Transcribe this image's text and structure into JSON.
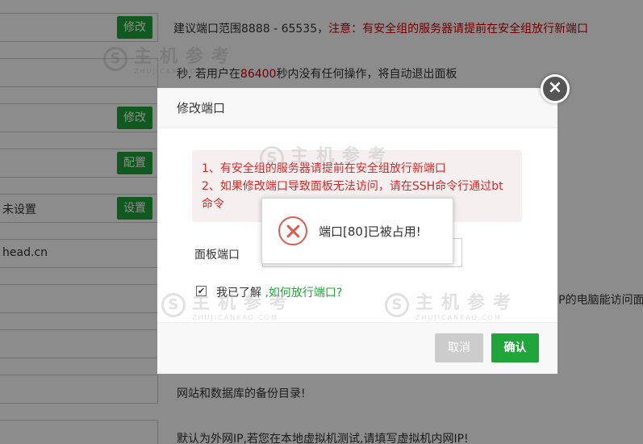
{
  "background": {
    "rows": [
      {
        "value": "",
        "button": "修改",
        "hint": "建议端口范围8888 - 65535，",
        "hint_red": "注意：有安全组的服务器请提前在安全组放行新端口"
      },
      {
        "value": "",
        "hint": "秒, 若用户在",
        "hint_num": "86400",
        "hint_tail": "秒内没有任何操作，将自动退出面板"
      },
      {
        "value": "",
        "button": "修改"
      },
      {
        "value": "",
        "button": "配置"
      },
      {
        "value": "未设置",
        "button": "设置"
      },
      {
        "value": "head.cn"
      },
      {
        "value": "",
        "hint": "IP的电脑能访问面"
      },
      {
        "value": ""
      },
      {
        "value": ""
      },
      {
        "value": "",
        "hint": "网站和数据库的备份目录!"
      },
      {
        "value": "",
        "hint": "默认为外网IP,若您在本地虚拟机测试,请填写虚拟机内网IP!"
      }
    ],
    "watermark_cn": "主机参考",
    "watermark_en": "ZHUJICANKAO.COM"
  },
  "modal": {
    "title": "修改端口",
    "warning_line1": "1、有安全组的服务器请提前在安全组放行新端口",
    "warning_line2": "2、如果修改端口导致面板无法访问，请在SSH命令行通过bt命令",
    "port_label": "面板端口",
    "port_value": "",
    "checkbox_label": "我已了解 ",
    "checkbox_link": ",如何放行端口?",
    "cancel_label": "取消",
    "confirm_label": "确认",
    "close_glyph": "×"
  },
  "toast": {
    "message": "端口[80]已被占用!"
  },
  "colors": {
    "accent": "#20a53a",
    "warning_text": "#d62728",
    "error_icon": "#e05a4e"
  }
}
